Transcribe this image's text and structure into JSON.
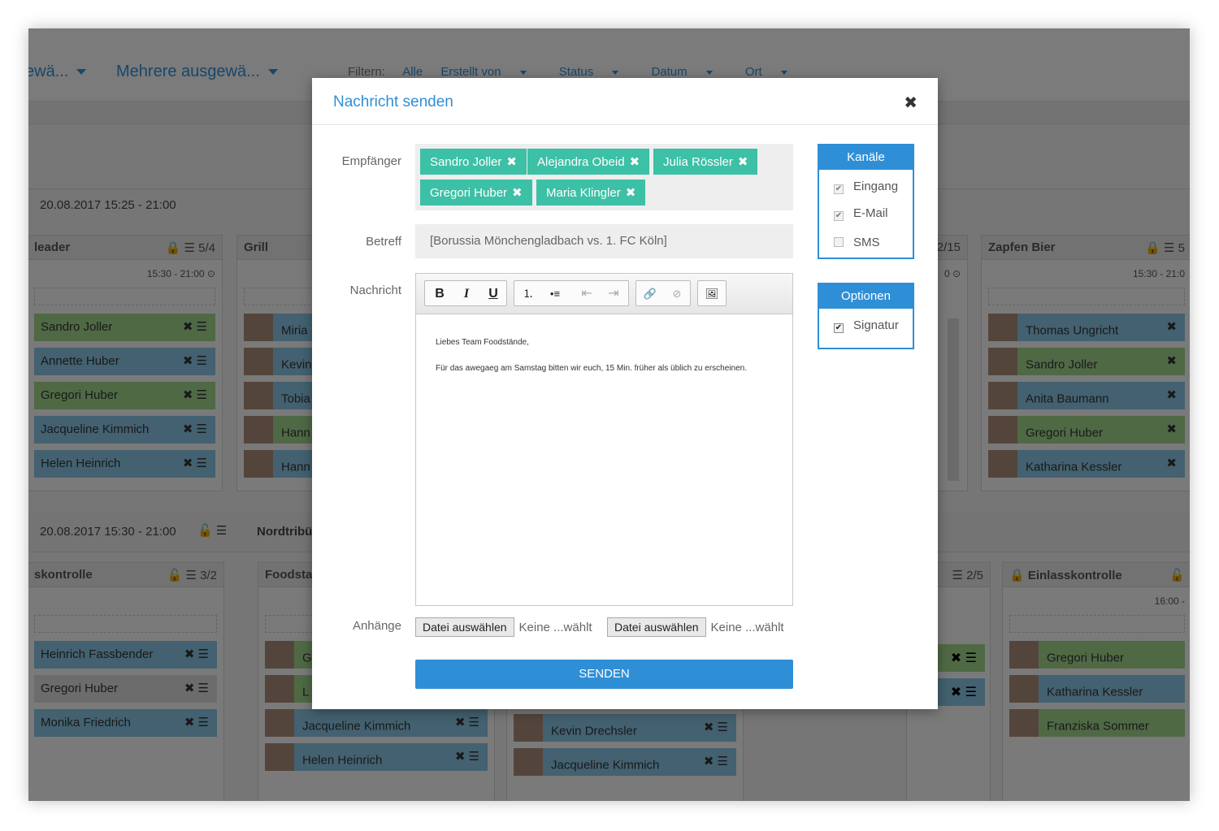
{
  "header": {
    "select_left": "ewä...",
    "select_main": "Mehrere ausgewä...",
    "filter_label": "Filtern:",
    "filters": [
      "Alle",
      "Erstellt von",
      "Status",
      "Datum",
      "Ort"
    ]
  },
  "shifts": {
    "shift1_label": "20.08.2017   15:25 - 21:00",
    "shift2_label": "20.08.2017   15:30 - 21:00",
    "shift2_icons": "🔓 ☰",
    "columns_top": [
      {
        "title": "leader",
        "count": "🔒 ☰ 5/4",
        "time": "15:30 - 21:00 ⊙",
        "people": [
          "Sandro Joller",
          "Annette Huber",
          "Gregori Huber",
          "Jacqueline Kimmich",
          "Helen Heinrich"
        ]
      },
      {
        "title": "Grill",
        "people": [
          "Miria",
          "Kevin",
          "Tobia",
          "Hann",
          "Hann"
        ]
      },
      {
        "count": "2/15",
        "time": "0 ⊙"
      },
      {
        "title": "Zapfen Bier",
        "count": "🔒 ☰ 5",
        "time": "15:30 - 21:0",
        "people": [
          "Thomas Ungricht",
          "Sandro Joller",
          "Anita Baumann",
          "Gregori Huber",
          "Katharina Kessler"
        ]
      }
    ],
    "columns_bottom": [
      {
        "title": "skontrolle",
        "count": "🔓 ☰ 3/2",
        "people": [
          "Heinrich Fassbender",
          "Gregori Huber",
          "Monika Friedrich"
        ]
      },
      {
        "title": "Nordtribü"
      },
      {
        "title": "Foodsta",
        "people": [
          "G",
          "L",
          "Jacqueline Kimmich",
          "Helen Heinrich"
        ]
      },
      {
        "people": [
          "Kevin Drechsler",
          "Jacqueline Kimmich"
        ]
      },
      {
        "count": "☰ 2/5"
      },
      {
        "title": "🔒 Einlasskontrolle",
        "count": "🔓",
        "time": "16:00 -",
        "people": [
          "Gregori Huber",
          "Katharina Kessler",
          "Franziska Sommer"
        ]
      }
    ],
    "item_actions": "✖ ☰",
    "item_remove": "✖"
  },
  "modal": {
    "title": "Nachricht senden",
    "close_icon": "✖",
    "recipients_label": "Empfänger",
    "recipients": [
      "Sandro Joller",
      "Alejandra Obeid",
      "Julia Rössler",
      "Gregori Huber",
      "Maria Klingler"
    ],
    "recipient_remove_icon": "✖",
    "subject_label": "Betreff",
    "subject_value": "[Borussia Mönchengladbach vs. 1. FC Köln]",
    "message_label": "Nachricht",
    "toolbar": {
      "bold": "B",
      "italic": "I",
      "underline": "U",
      "ordered_list": "⒈",
      "bullet_list": "•≡",
      "outdent": "⇤",
      "indent": "⇥",
      "link": "🔗",
      "unlink": "⊘",
      "image": "🖼"
    },
    "message_lines": [
      "Liebes Team Foodstände,",
      "Für das awegaeg am Samstag bitten wir euch, 15 Min. früher als üblich zu erscheinen."
    ],
    "attachments_label": "Anhänge",
    "file_button": "Datei auswählen",
    "file_status": "Keine ...wählt",
    "send_button": "SENDEN",
    "channels": {
      "title": "Kanäle",
      "options": [
        {
          "label": "Eingang",
          "checked": true
        },
        {
          "label": "E-Mail",
          "checked": true
        },
        {
          "label": "SMS",
          "checked": false
        }
      ]
    },
    "options": {
      "title": "Optionen",
      "signature": "Signatur",
      "signature_checked": true
    }
  },
  "colors": {
    "accent": "#2f8fd6",
    "tag": "#3cc0a6",
    "green_item": "#9ed38b",
    "blue_item": "#86c3e0"
  }
}
